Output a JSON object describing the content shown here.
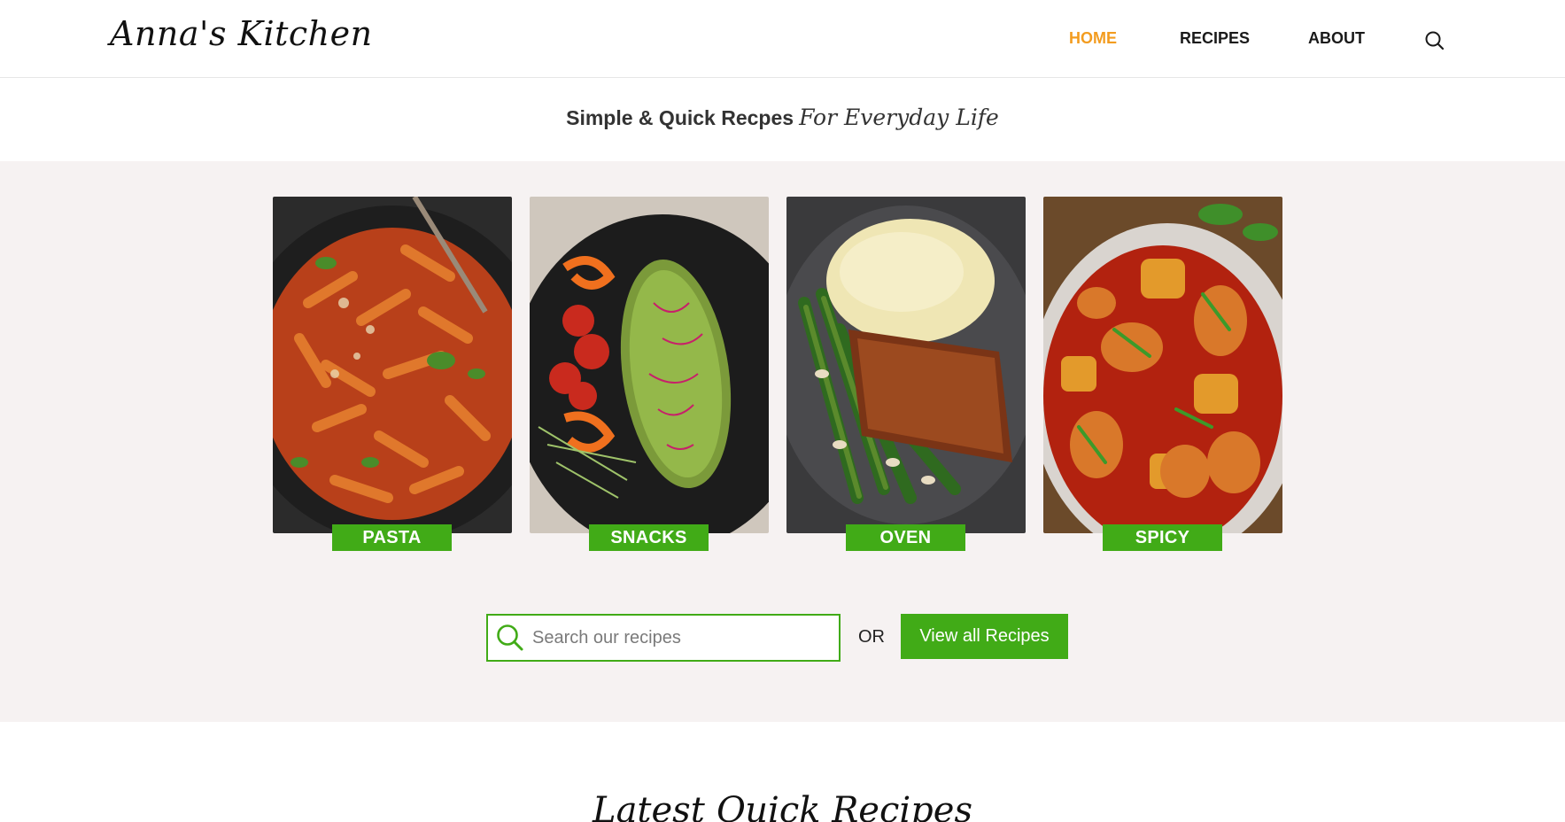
{
  "header": {
    "logo": "Anna's Kitchen",
    "nav": [
      {
        "label": "HOME",
        "active": true
      },
      {
        "label": "RECIPES",
        "active": false
      },
      {
        "label": "ABOUT",
        "active": false
      }
    ],
    "search_icon": "search-icon"
  },
  "tagline": {
    "plain": "Simple & Quick Recpes",
    "script": "For Everyday Life"
  },
  "categories": [
    {
      "label": "PASTA",
      "image": "pasta-photo"
    },
    {
      "label": "SNACKS",
      "image": "snacks-photo"
    },
    {
      "label": "OVEN",
      "image": "oven-photo"
    },
    {
      "label": "SPICY",
      "image": "spicy-photo"
    }
  ],
  "search": {
    "placeholder": "Search our recipes",
    "value": "",
    "icon": "search-icon",
    "or_text": "OR",
    "view_all_label": "View all Recipes"
  },
  "latest": {
    "heading": "Latest Quick Recipes"
  },
  "colors": {
    "accent_green": "#41ab17",
    "nav_active": "#f39c1f",
    "hero_bg": "#f6f2f2"
  }
}
